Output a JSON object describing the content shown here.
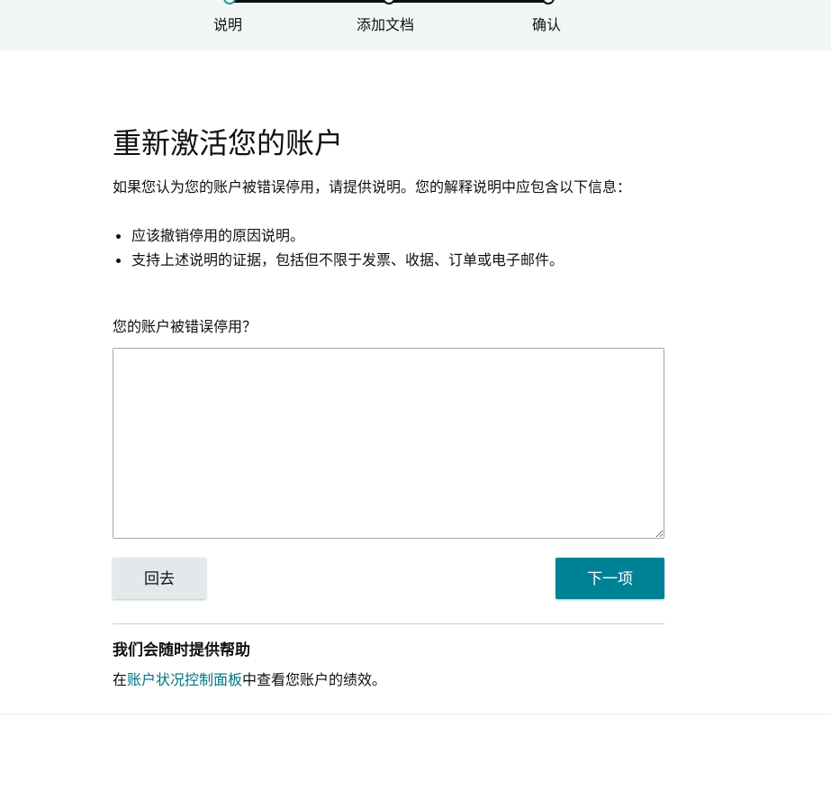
{
  "stepper": {
    "steps": [
      {
        "label": "说明",
        "state": "active"
      },
      {
        "label": "添加文档",
        "state": "pending"
      },
      {
        "label": "确认",
        "state": "pending"
      }
    ]
  },
  "page": {
    "title": "重新激活您的账户",
    "intro": "如果您认为您的账户被错误停用，请提供说明。您的解释说明中应包含以下信息：",
    "bullets": [
      "应该撤销停用的原因说明。",
      "支持上述说明的证据，包括但不限于发票、收据、订单或电子邮件。"
    ]
  },
  "form": {
    "question_label": "您的账户被错误停用？",
    "answer_value": "",
    "back_label": "回去",
    "next_label": "下一项"
  },
  "help": {
    "title": "我们会随时提供帮助",
    "text_before": "在",
    "link_text": "账户状况控制面板",
    "text_after": "中查看您账户的绩效。"
  },
  "colors": {
    "accent": "#008296",
    "active_step": "#1c9aa8",
    "link": "#007185",
    "back_button": "#e3e9ea",
    "topbar": "#f3f6f6"
  }
}
